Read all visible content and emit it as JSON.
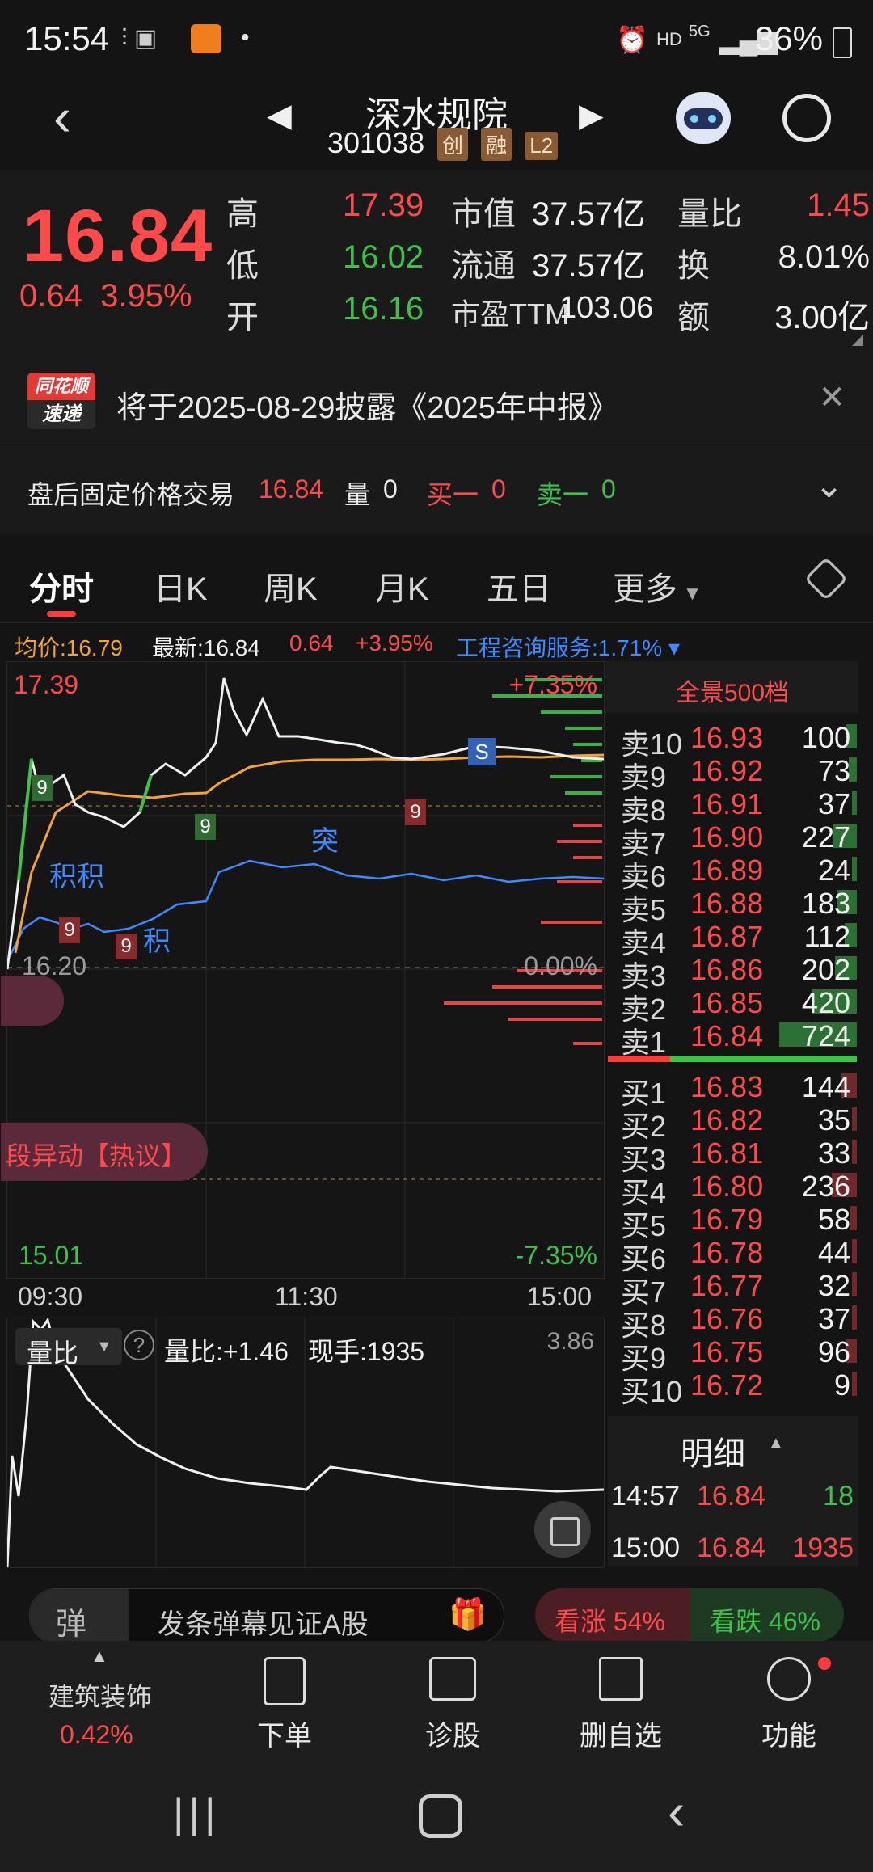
{
  "status": {
    "time": "15:54",
    "battery": "36%",
    "net": "HD",
    "net5g": "5G"
  },
  "header": {
    "title": "深水规院",
    "code": "301038",
    "tags": [
      "创",
      "融",
      "L2"
    ]
  },
  "quote": {
    "price": "16.84",
    "change": "0.64",
    "change_pct": "3.95%",
    "high_label": "高",
    "high": "17.39",
    "low_label": "低",
    "low": "16.02",
    "open_label": "开",
    "open": "16.16",
    "mcap_label": "市值",
    "mcap": "37.57亿",
    "float_label": "流通",
    "float": "37.57亿",
    "pe_label": "市盈TTM",
    "pe": "103.06",
    "vr_label": "量比",
    "vr": "1.45",
    "turn_label": "换",
    "turn": "8.01%",
    "amt_label": "额",
    "amt": "3.00亿"
  },
  "notice": {
    "badge_top": "同花顺",
    "badge_bottom": "速递",
    "text": "将于2025-08-29披露《2025年中报》"
  },
  "afterhours": {
    "label": "盘后固定价格交易",
    "price": "16.84",
    "vol_label": "量",
    "vol": "0",
    "buy_label": "买一",
    "buy": "0",
    "sell_label": "卖一",
    "sell": "0"
  },
  "tabs": [
    "分时",
    "日K",
    "周K",
    "月K",
    "五日",
    "更多"
  ],
  "infoline": {
    "avg_label": "均价:",
    "avg": "16.79",
    "last_label": "最新:",
    "last": "16.84",
    "chg": "0.64",
    "pct": "+3.95%",
    "sector": "工程咨询服务:1.71%"
  },
  "chart": {
    "top_price": "17.39",
    "top_pct": "+7.35%",
    "mid_price": "16.20",
    "mid_pct": "0.00%",
    "bottom_price": "15.01",
    "bottom_pct": "-7.35%",
    "times": [
      "09:30",
      "11:30",
      "15:00"
    ],
    "hot_label": "段异动【热议】",
    "markers": {
      "s": "S",
      "tu": "突",
      "ji1": "积积",
      "ji2": "积",
      "nine": "9"
    },
    "sub_label": "量比",
    "sub_vr": "量比:+1.46",
    "sub_now": "现手:1935",
    "sub_max": "3.86"
  },
  "orderbook": {
    "title": "全景500档",
    "sells": [
      {
        "label": "卖10",
        "price": "16.93",
        "vol": "100"
      },
      {
        "label": "卖9",
        "price": "16.92",
        "vol": "73"
      },
      {
        "label": "卖8",
        "price": "16.91",
        "vol": "37"
      },
      {
        "label": "卖7",
        "price": "16.90",
        "vol": "227"
      },
      {
        "label": "卖6",
        "price": "16.89",
        "vol": "24"
      },
      {
        "label": "卖5",
        "price": "16.88",
        "vol": "183"
      },
      {
        "label": "卖4",
        "price": "16.87",
        "vol": "112"
      },
      {
        "label": "卖3",
        "price": "16.86",
        "vol": "202"
      },
      {
        "label": "卖2",
        "price": "16.85",
        "vol": "420"
      },
      {
        "label": "卖1",
        "price": "16.84",
        "vol": "724"
      }
    ],
    "buys": [
      {
        "label": "买1",
        "price": "16.83",
        "vol": "144"
      },
      {
        "label": "买2",
        "price": "16.82",
        "vol": "35"
      },
      {
        "label": "买3",
        "price": "16.81",
        "vol": "33"
      },
      {
        "label": "买4",
        "price": "16.80",
        "vol": "236"
      },
      {
        "label": "买5",
        "price": "16.79",
        "vol": "58"
      },
      {
        "label": "买6",
        "price": "16.78",
        "vol": "44"
      },
      {
        "label": "买7",
        "price": "16.77",
        "vol": "32"
      },
      {
        "label": "买8",
        "price": "16.76",
        "vol": "37"
      },
      {
        "label": "买9",
        "price": "16.75",
        "vol": "96"
      },
      {
        "label": "买10",
        "price": "16.72",
        "vol": "9"
      }
    ],
    "detail_title": "明细",
    "ticks": [
      {
        "time": "14:57",
        "price": "16.84",
        "vol": "18"
      },
      {
        "time": "15:00",
        "price": "16.84",
        "vol": "1935"
      }
    ]
  },
  "bottom_bar": {
    "danmu_icon": "弹",
    "danmu_text": "发条弹幕见证A股",
    "up": "看涨 54%",
    "down": "看跌 46%"
  },
  "nav": {
    "sector_name": "建筑装饰",
    "sector_pct": "0.42%",
    "items": [
      "下单",
      "诊股",
      "删自选",
      "功能"
    ]
  },
  "colors": {
    "up": "#ff4a4a",
    "down": "#3fc24a",
    "avg": "#f2a43a",
    "sector": "#3d8bff",
    "bg": "#141414"
  }
}
